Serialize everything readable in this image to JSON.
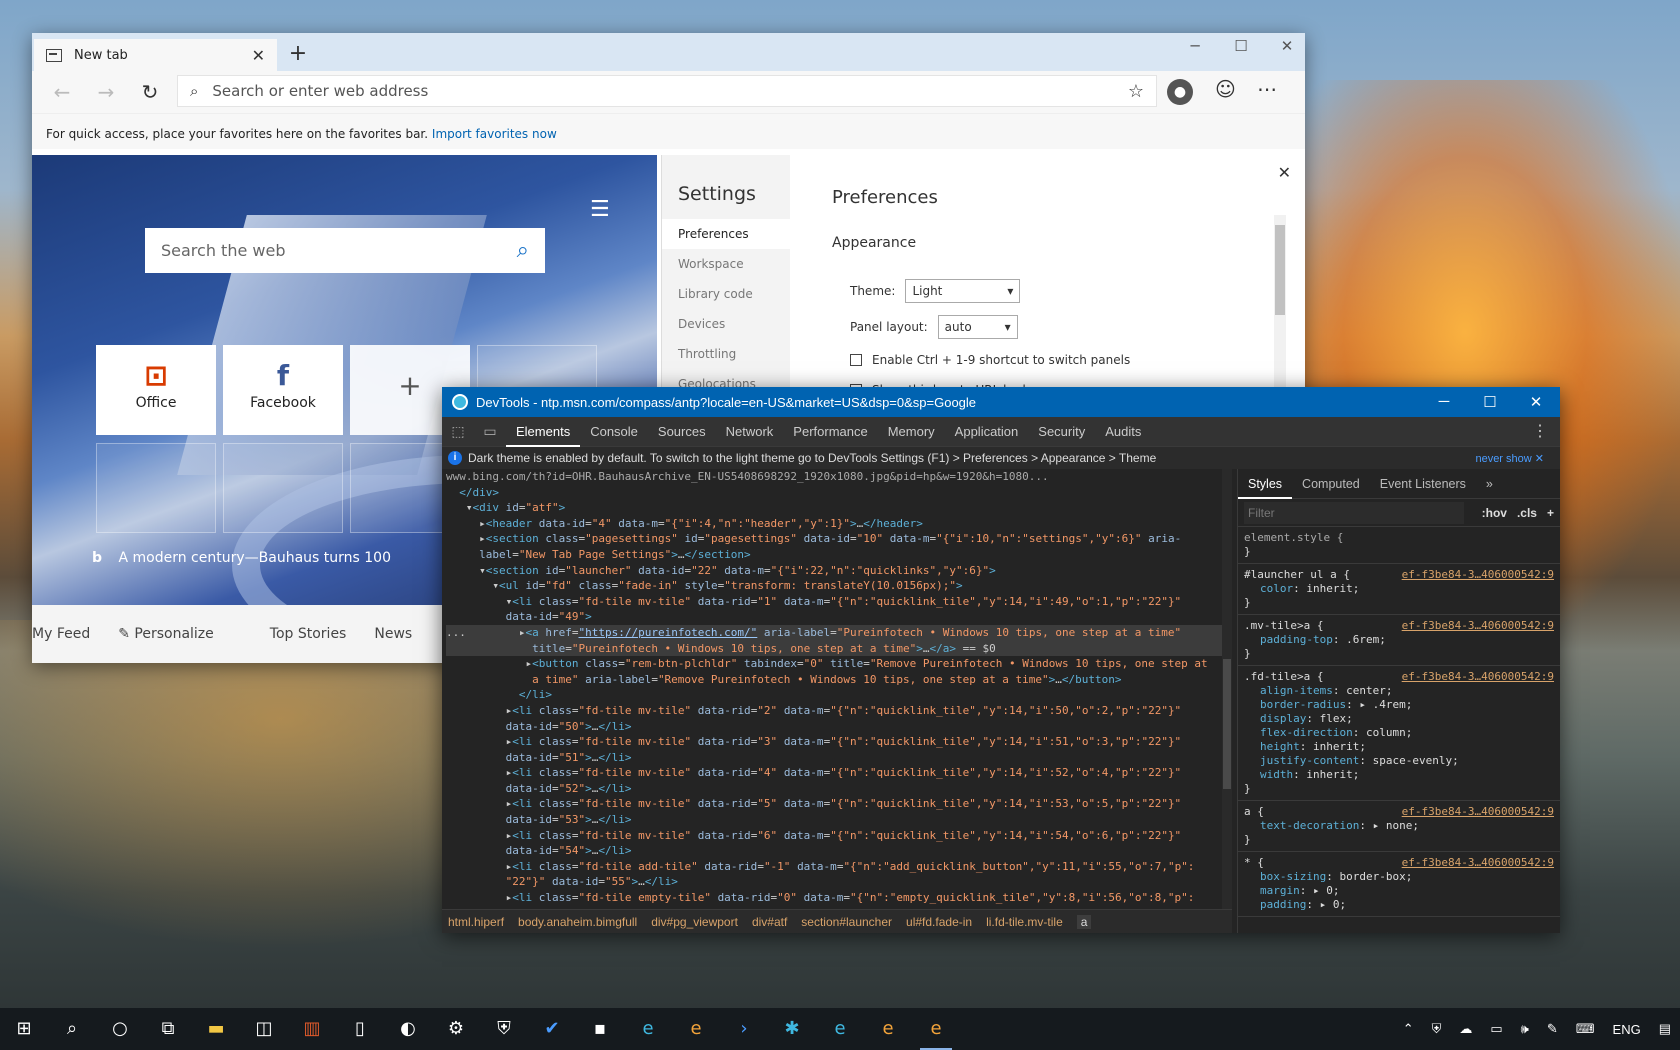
{
  "browser": {
    "tab_title": "New tab",
    "address_placeholder": "Search or enter web address",
    "favbar_text": "For quick access, place your favorites here on the favorites bar.",
    "favbar_link": "Import favorites now"
  },
  "ntp": {
    "search_placeholder": "Search the web",
    "tiles": [
      {
        "label": "Office",
        "icon": "office-icon",
        "color": "#d83b01"
      },
      {
        "label": "Facebook",
        "icon": "facebook-icon",
        "color": "#3b5998"
      }
    ],
    "caption": "A modern century—Bauhaus turns 100",
    "nav": [
      "My Feed",
      "Personalize",
      "Top Stories",
      "News"
    ]
  },
  "settings": {
    "title": "Settings",
    "items": [
      "Preferences",
      "Workspace",
      "Library code",
      "Devices",
      "Throttling",
      "Geolocations"
    ],
    "heading": "Preferences",
    "section": "Appearance",
    "theme_label": "Theme:",
    "theme_value": "Light",
    "layout_label": "Panel layout:",
    "layout_value": "auto",
    "check1": "Enable Ctrl + 1-9 shortcut to switch panels",
    "check2": "Show third party URL badges"
  },
  "devtools": {
    "title": "DevTools - ntp.msn.com/compass/antp?locale=en-US&market=US&dsp=0&sp=Google",
    "tabs": [
      "Elements",
      "Console",
      "Sources",
      "Network",
      "Performance",
      "Memory",
      "Application",
      "Security",
      "Audits"
    ],
    "info": "Dark theme is enabled by default. To switch to the light theme go to DevTools Settings (F1) > Preferences > Appearance > Theme",
    "never_show": "never show",
    "breadcrumb": [
      "html.hiperf",
      "body.anaheim.bimgfull",
      "div#pg_viewport",
      "div#atf",
      "section#launcher",
      "ul#fd.fade-in",
      "li.fd-tile.mv-tile",
      "a"
    ],
    "styles_tabs": [
      "Styles",
      "Computed",
      "Event Listeners"
    ],
    "filter": "Filter",
    "hov": ":hov",
    "cls": ".cls",
    "rules": [
      {
        "sel": "element.style {",
        "src": "",
        "props": []
      },
      {
        "sel": "#launcher ul a {",
        "src": "ef-f3be84-3…406000542:9",
        "props": [
          [
            "color",
            "inherit;"
          ]
        ]
      },
      {
        "sel": ".mv-tile>a {",
        "src": "ef-f3be84-3…406000542:9",
        "props": [
          [
            "padding-top",
            ".6rem;"
          ]
        ]
      },
      {
        "sel": ".fd-tile>a {",
        "src": "ef-f3be84-3…406000542:9",
        "props": [
          [
            "align-items",
            "center;"
          ],
          [
            "border-radius",
            "▸ .4rem;"
          ],
          [
            "display",
            "flex;"
          ],
          [
            "flex-direction",
            "column;"
          ],
          [
            "height",
            "inherit;"
          ],
          [
            "justify-content",
            "space-evenly;"
          ],
          [
            "width",
            "inherit;"
          ]
        ]
      },
      {
        "sel": "a {",
        "src": "ef-f3be84-3…406000542:9",
        "props": [
          [
            "text-decoration",
            "▸ none;"
          ]
        ]
      },
      {
        "sel": "* {",
        "src": "ef-f3be84-3…406000542:9",
        "props": [
          [
            "box-sizing",
            "border-box;"
          ],
          [
            "margin",
            "▸ 0;"
          ],
          [
            "padding",
            "▸ 0;"
          ]
        ]
      }
    ]
  },
  "tray": {
    "lang": "ENG"
  }
}
